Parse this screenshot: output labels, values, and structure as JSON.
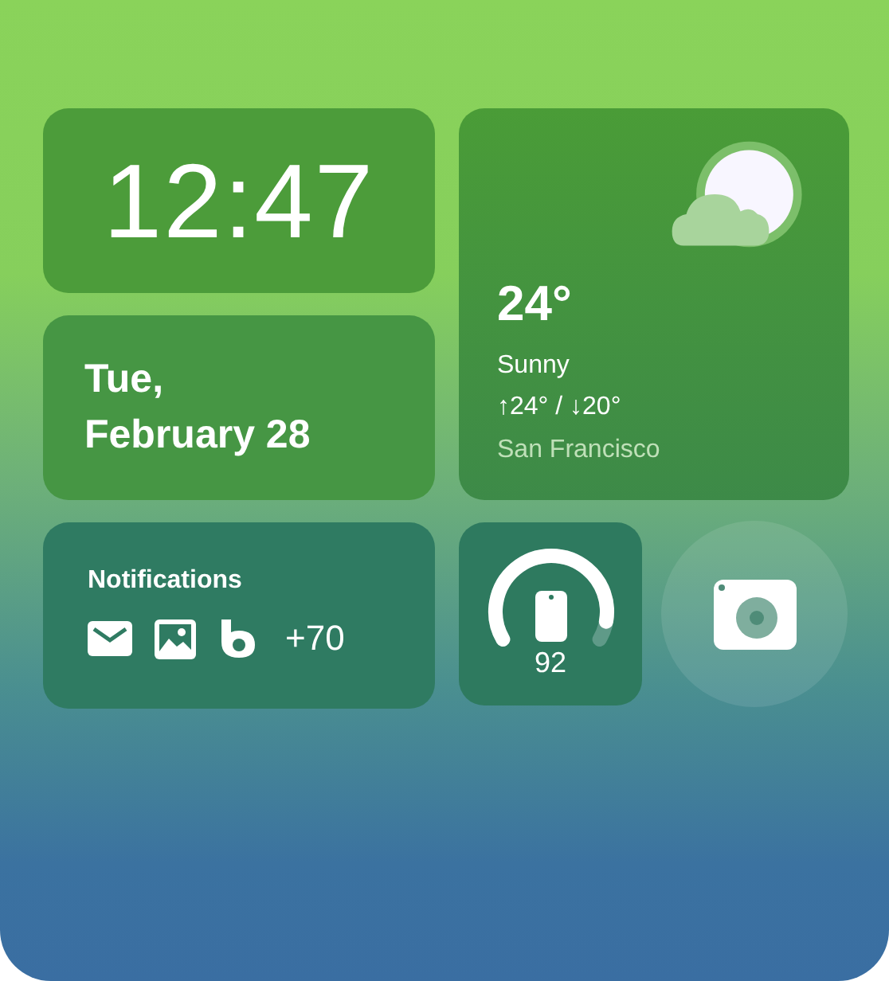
{
  "clock": {
    "time": "12:47"
  },
  "date": {
    "weekday": "Tue,",
    "day": "February 28"
  },
  "weather": {
    "temperature": "24°",
    "condition": "Sunny",
    "range": "↑24° / ↓20°",
    "city": "San Francisco"
  },
  "notifications": {
    "title": "Notifications",
    "count": "+70"
  },
  "battery": {
    "reading": "92"
  }
}
